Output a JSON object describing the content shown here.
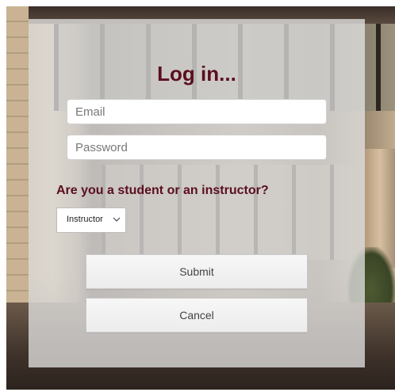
{
  "login": {
    "title": "Log in...",
    "email_placeholder": "Email",
    "password_placeholder": "Password",
    "role_question": "Are you a student or an instructor?",
    "role_selected": "Instructor",
    "submit_label": "Submit",
    "cancel_label": "Cancel"
  },
  "colors": {
    "heading": "#5a0f1e",
    "panel_bg": "rgba(232,232,232,0.74)"
  },
  "icons": {
    "select_arrow": "chevron-down-icon"
  }
}
